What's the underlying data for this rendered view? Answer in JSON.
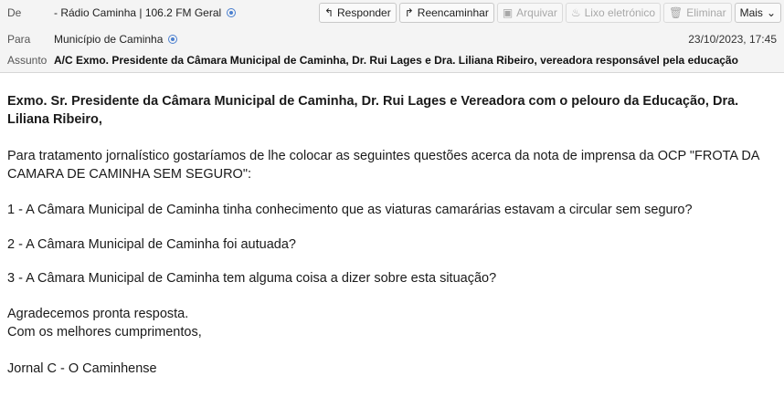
{
  "header": {
    "from_label": "De",
    "from_value": "- Rádio Caminha | 106.2 FM Geral",
    "to_label": "Para",
    "to_value": "Município de Caminha",
    "subject_label": "Assunto",
    "subject_value": "A/C Exmo. Presidente da Câmara Municipal de Caminha, Dr. Rui Lages e Dra. Liliana Ribeiro, vereadora responsável pela educação",
    "date": "23/10/2023, 17:45"
  },
  "toolbar": {
    "reply": "Responder",
    "forward": "Reencaminhar",
    "archive": "Arquivar",
    "junk": "Lixo eletrónico",
    "delete": "Eliminar",
    "more": "Mais"
  },
  "message": {
    "greeting": "Exmo. Sr. Presidente da Câmara Municipal de Caminha, Dr. Rui Lages e Vereadora com o pelouro da Educação, Dra. Liliana Ribeiro,",
    "intro": "Para tratamento jornalístico gostaríamos de lhe colocar as seguintes questões acerca da nota de imprensa da OCP \"FROTA DA CAMARA DE CAMINHA SEM SEGURO\":",
    "q1": "1 - A Câmara Municipal de Caminha tinha conhecimento que as viaturas camarárias estavam a circular sem seguro?",
    "q2": "2 - A Câmara Municipal de Caminha foi autuada?",
    "q3": "3 - A Câmara Municipal de Caminha tem alguma coisa a dizer sobre esta situação?",
    "closing1": "Agradecemos pronta resposta.",
    "closing2": "Com os melhores cumprimentos,",
    "signature": "Jornal C - O Caminhense"
  }
}
